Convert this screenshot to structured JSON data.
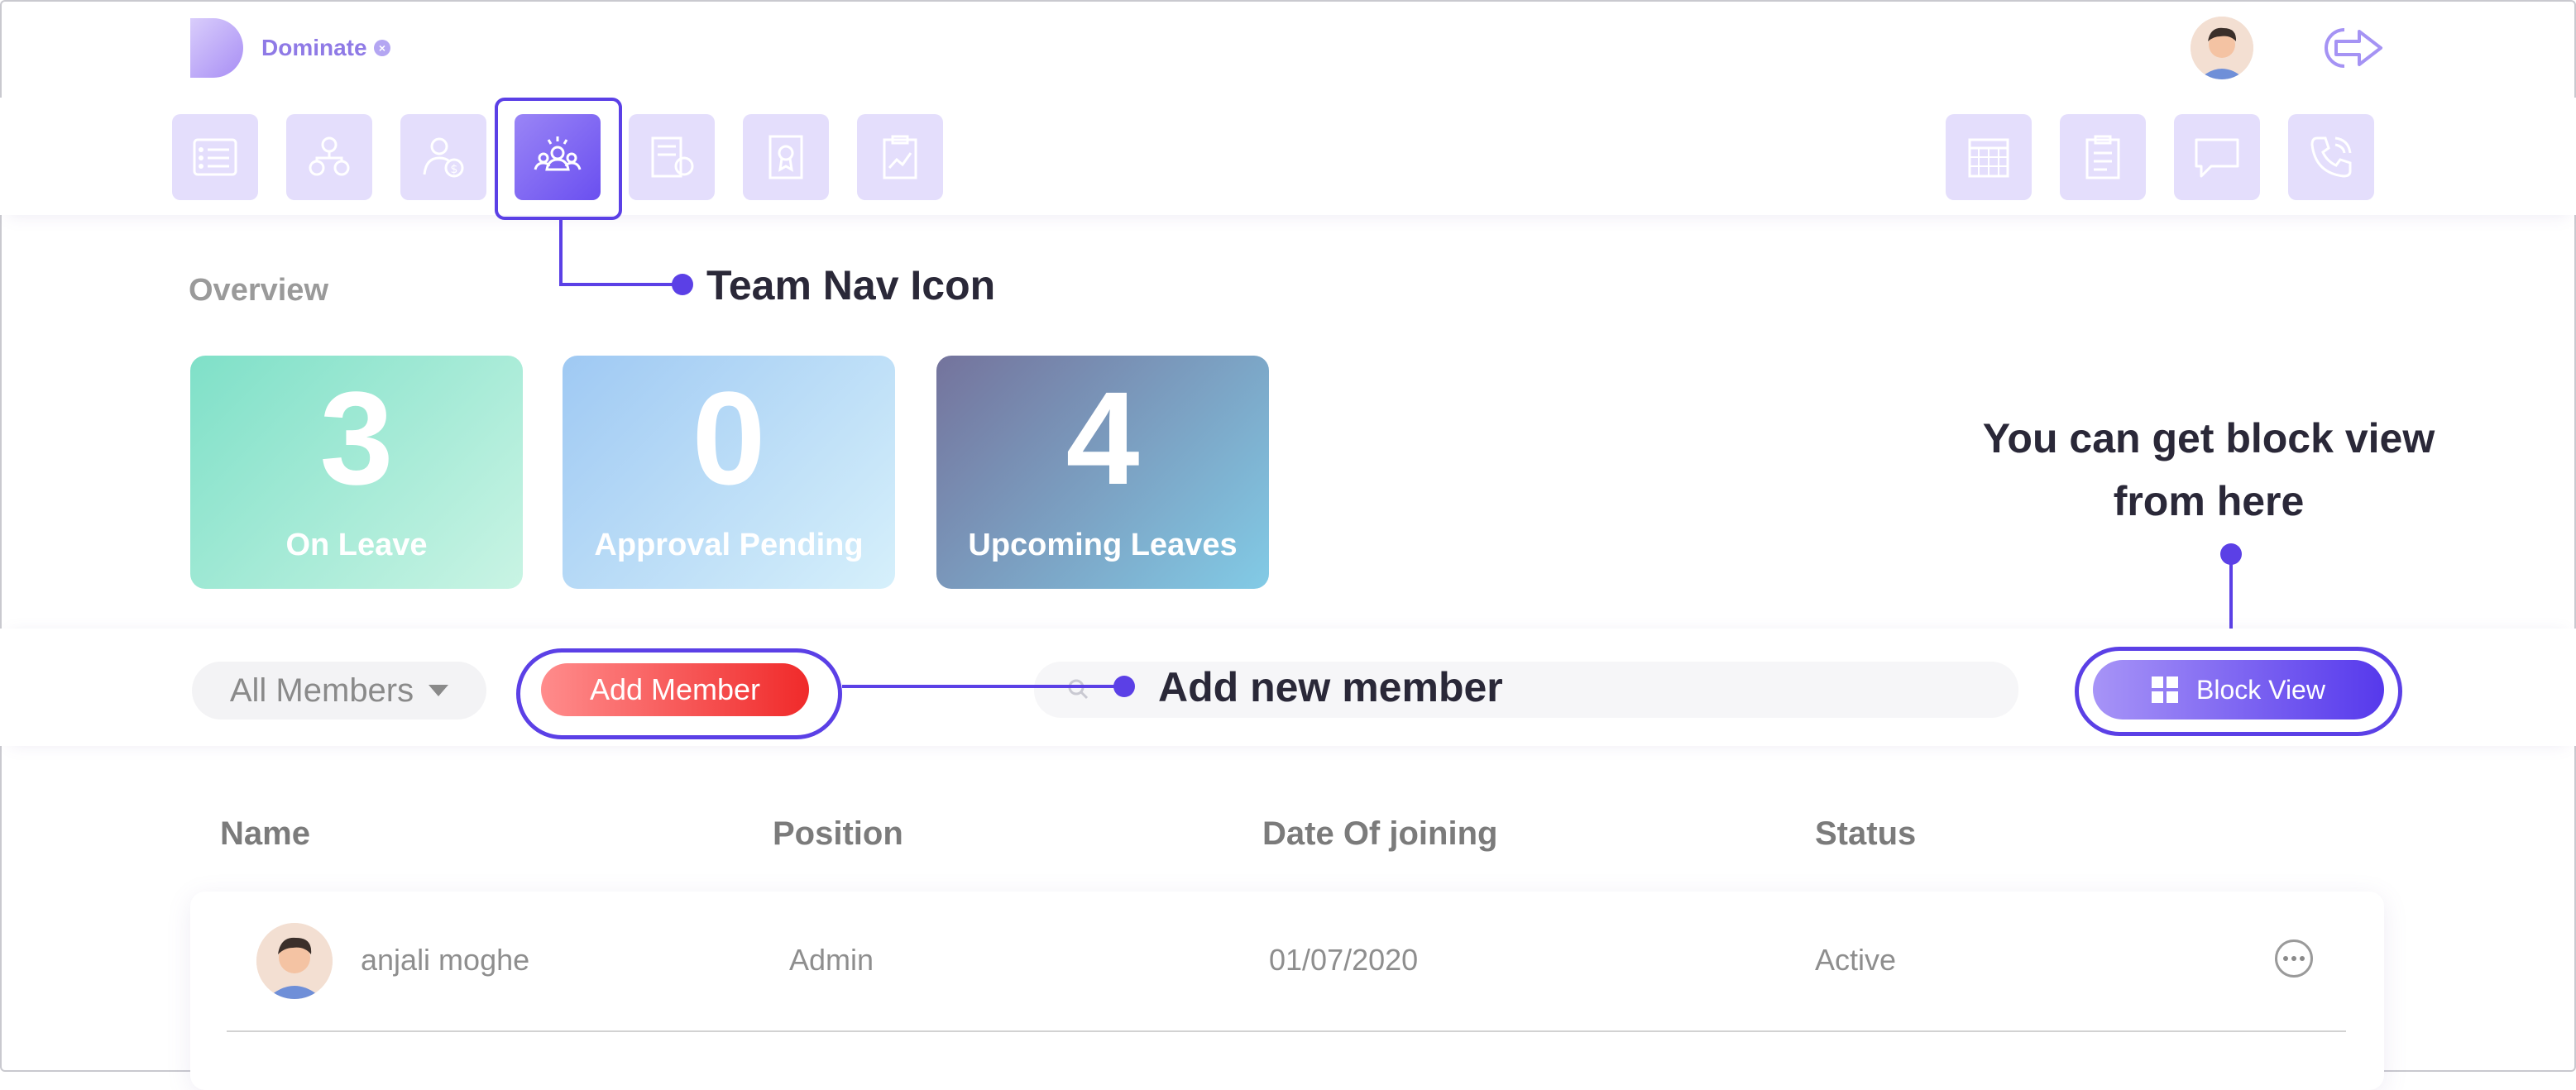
{
  "app": {
    "brand": "Dominate",
    "brand_close": "×"
  },
  "colors": {
    "accent": "#5b40e6",
    "nav_tile": "#e4defc",
    "add_member": "#f02a2a",
    "block_view": "#5639ec"
  },
  "nav": {
    "left_items": [
      {
        "name": "list-nav",
        "icon": "list-icon"
      },
      {
        "name": "org-nav",
        "icon": "org-chart-icon"
      },
      {
        "name": "payroll-nav",
        "icon": "user-dollar-icon"
      },
      {
        "name": "team-nav",
        "icon": "team-icon",
        "active": true
      },
      {
        "name": "invoice-nav",
        "icon": "invoice-icon"
      },
      {
        "name": "policy-nav",
        "icon": "document-award-icon"
      },
      {
        "name": "report-nav",
        "icon": "clipboard-chart-icon"
      }
    ],
    "right_items": [
      {
        "name": "calendar-nav",
        "icon": "calendar-icon"
      },
      {
        "name": "tasks-nav",
        "icon": "clipboard-list-icon"
      },
      {
        "name": "chat-nav",
        "icon": "chat-icon"
      },
      {
        "name": "call-nav",
        "icon": "phone-icon"
      }
    ]
  },
  "annotations": {
    "team_nav": "Team Nav Icon",
    "block_view_line1": "You can get block view",
    "block_view_line2": "from here",
    "add_member": "Add new member"
  },
  "overview": {
    "title": "Overview",
    "cards": [
      {
        "value": "3",
        "label": "On Leave"
      },
      {
        "value": "0",
        "label": "Approval Pending"
      },
      {
        "value": "4",
        "label": "Upcoming Leaves"
      }
    ]
  },
  "toolbar": {
    "filter_value": "All Members",
    "add_member_label": "Add Member",
    "search_placeholder": "",
    "block_view_label": "Block View"
  },
  "table": {
    "columns": [
      "Name",
      "Position",
      "Date Of joining",
      "Status"
    ],
    "rows": [
      {
        "name": "anjali moghe",
        "position": "Admin",
        "date": "01/07/2020",
        "status": "Active"
      }
    ]
  }
}
